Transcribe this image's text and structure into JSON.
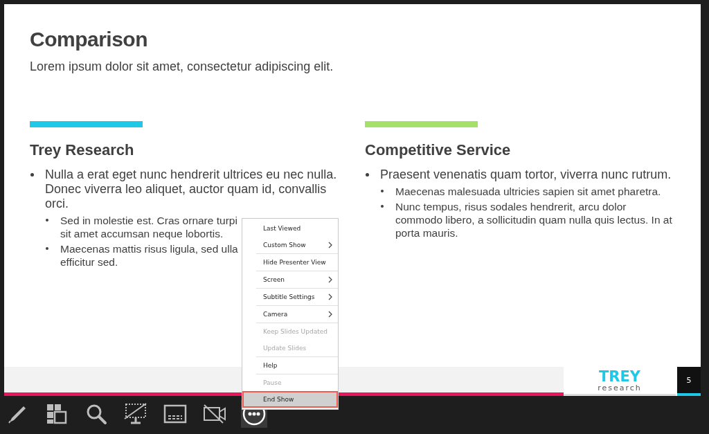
{
  "slide": {
    "title": "Comparison",
    "subtitle": "Lorem ipsum dolor sit amet, consectetur adipiscing elit.",
    "columns": [
      {
        "color": "#1ec8e6",
        "heading": "Trey Research",
        "bullets": [
          {
            "lines": [
              "Nulla a erat eget nunc hendrerit ultrices eu nec nulla. Donec viverra leo aliquet, auctor quam id, convallis orci."
            ],
            "children": [
              {
                "lines": [
                  "Sed in molestie est. Cras ornare turpi",
                  "sit amet accumsan neque lobortis."
                ]
              },
              {
                "lines": [
                  "Maecenas mattis risus ligula, sed ulla",
                  "efficitur sed."
                ]
              }
            ]
          }
        ]
      },
      {
        "color": "#a5e06a",
        "heading": "Competitive Service",
        "bullets": [
          {
            "lines": [
              "Praesent venenatis quam tortor, viverra nunc rutrum."
            ],
            "children": [
              {
                "lines": [
                  "Maecenas malesuada ultricies sapien sit amet pharetra."
                ]
              },
              {
                "lines": [
                  "Nunc tempus, risus sodales hendrerit, arcu dolor commodo libero, a sollicitudin quam nulla quis lectus. In at porta mauris."
                ]
              }
            ]
          }
        ]
      }
    ],
    "logo": {
      "word": "TREY",
      "sub": "research"
    },
    "page_number": "5"
  },
  "menu": {
    "groups": [
      [
        {
          "label": "Last Viewed",
          "kind": "item",
          "disabled": false,
          "selected": false
        },
        {
          "label": "Custom Show",
          "kind": "submenu",
          "disabled": false,
          "selected": false
        }
      ],
      [
        {
          "label": "Hide Presenter View",
          "kind": "item",
          "disabled": false,
          "selected": false
        }
      ],
      [
        {
          "label": "Screen",
          "kind": "submenu",
          "disabled": false,
          "selected": false
        }
      ],
      [
        {
          "label": "Subtitle Settings",
          "kind": "submenu",
          "disabled": false,
          "selected": false
        }
      ],
      [
        {
          "label": "Camera",
          "kind": "submenu",
          "disabled": false,
          "selected": false
        }
      ],
      [
        {
          "label": "Keep Slides Updated",
          "kind": "item",
          "disabled": true,
          "selected": false
        },
        {
          "label": "Update Slides",
          "kind": "item",
          "disabled": true,
          "selected": false
        }
      ],
      [
        {
          "label": "Help",
          "kind": "item",
          "disabled": false,
          "selected": false
        }
      ],
      [
        {
          "label": "Pause",
          "kind": "item",
          "disabled": true,
          "selected": false
        },
        {
          "label": "End Show",
          "kind": "item",
          "disabled": false,
          "selected": true
        }
      ]
    ]
  },
  "toolbar": [
    {
      "kind": "pen",
      "selected": false
    },
    {
      "kind": "slides",
      "selected": false
    },
    {
      "kind": "zoom",
      "selected": false
    },
    {
      "kind": "screen",
      "selected": false
    },
    {
      "kind": "subtitles",
      "selected": false
    },
    {
      "kind": "camera",
      "selected": false
    },
    {
      "kind": "more",
      "selected": true
    }
  ]
}
